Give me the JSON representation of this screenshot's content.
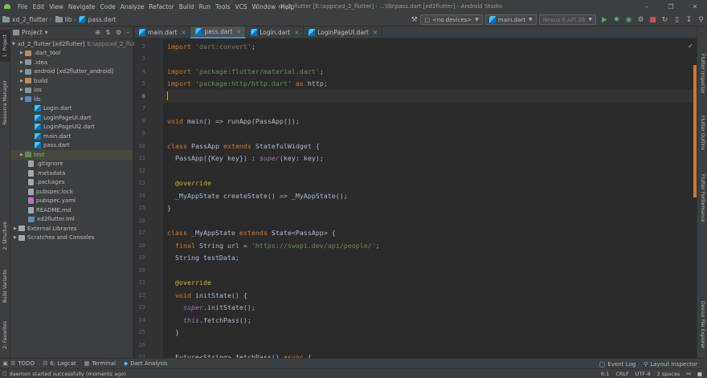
{
  "menubar": {
    "items": [
      "File",
      "Edit",
      "View",
      "Navigate",
      "Code",
      "Analyze",
      "Refactor",
      "Build",
      "Run",
      "Tools",
      "VCS",
      "Window",
      "Help"
    ],
    "window_title": "xd_2_flutter [E:\\apps\\xd_2_flutter] - ...\\lib\\pass.dart [xd2flutter] - Android Studio"
  },
  "navbar": {
    "breadcrumbs": [
      "xd_2_flutter",
      "lib",
      "pass.dart"
    ],
    "device_combo": "<no devices>",
    "run_config": "main.dart",
    "emulator": "Nexus 6 API 28"
  },
  "left_stripe": {
    "tabs": [
      "1: Project",
      "Resource Manager",
      "2: Structure",
      "Build Variants",
      "2: Favorites"
    ]
  },
  "right_stripe": {
    "tabs": [
      "Flutter Inspector",
      "Flutter Outline",
      "Flutter Performance",
      "Device File Explorer"
    ]
  },
  "project": {
    "header": "Project",
    "root_label": "xd_2_flutter [xd2flutter]",
    "root_path": "E:\\apps\\xd_2_flutter",
    "items": [
      {
        "label": ".dart_tool"
      },
      {
        "label": ".idea"
      },
      {
        "label": "android [xd2flutter_android]"
      },
      {
        "label": "build"
      },
      {
        "label": "ios"
      },
      {
        "label": "lib"
      },
      {
        "label": "Login.dart"
      },
      {
        "label": "LoginPageUI.dart"
      },
      {
        "label": "LoginPageUI2.dart"
      },
      {
        "label": "main.dart"
      },
      {
        "label": "pass.dart"
      },
      {
        "label": "test"
      },
      {
        "label": ".gitignore"
      },
      {
        "label": ".metadata"
      },
      {
        "label": ".packages"
      },
      {
        "label": "pubspec.lock"
      },
      {
        "label": "pubspec.yaml"
      },
      {
        "label": "README.md"
      },
      {
        "label": "xd2flutter.iml"
      },
      {
        "label": "External Libraries"
      },
      {
        "label": "Scratches and Consoles"
      }
    ]
  },
  "editor": {
    "tabs": [
      "main.dart",
      "pass.dart",
      "Login.dart",
      "LoginPageUI.dart"
    ],
    "active_tab": "pass.dart",
    "lines": [
      {
        "n": "2",
        "text": "import 'dart:convert';"
      },
      {
        "n": "3",
        "text": ""
      },
      {
        "n": "4",
        "text": "import 'package:flutter/material.dart';"
      },
      {
        "n": "5",
        "text": "import 'package:http/http.dart' as http;"
      },
      {
        "n": "6",
        "text": ""
      },
      {
        "n": "7",
        "text": ""
      },
      {
        "n": "8",
        "text": "void main() => runApp(PassApp());"
      },
      {
        "n": "9",
        "text": ""
      },
      {
        "n": "10",
        "text": "class PassApp extends StatefulWidget {"
      },
      {
        "n": "11",
        "text": "  PassApp({Key key}) : super(key: key);"
      },
      {
        "n": "12",
        "text": ""
      },
      {
        "n": "13",
        "text": "  @override"
      },
      {
        "n": "14",
        "text": "  _MyAppState createState() => _MyAppState();"
      },
      {
        "n": "15",
        "text": "}"
      },
      {
        "n": "16",
        "text": ""
      },
      {
        "n": "17",
        "text": "class _MyAppState extends State<PassApp> {"
      },
      {
        "n": "18",
        "text": "  final String url = 'https://swapi.dev/api/people/';"
      },
      {
        "n": "19",
        "text": "  String testData;"
      },
      {
        "n": "20",
        "text": ""
      },
      {
        "n": "21",
        "text": "  @override"
      },
      {
        "n": "22",
        "text": "  void initState() {"
      },
      {
        "n": "23",
        "text": "    super.initState();"
      },
      {
        "n": "24",
        "text": "    this.fetchPass();"
      },
      {
        "n": "25",
        "text": "  }"
      },
      {
        "n": "26",
        "text": ""
      },
      {
        "n": "27",
        "text": "  Future<String> fetchPass() async {"
      }
    ]
  },
  "bottombar": {
    "tools": [
      "TODO",
      "6: Logcat",
      "Terminal",
      "Dart Analysis"
    ],
    "right_tools": [
      "Event Log",
      "Layout Inspector"
    ]
  },
  "statusbar": {
    "message": "daemon started successfully (moments ago)",
    "position": "6:1",
    "line_sep": "CRLF",
    "encoding": "UTF-8",
    "indent": "2 spaces"
  }
}
